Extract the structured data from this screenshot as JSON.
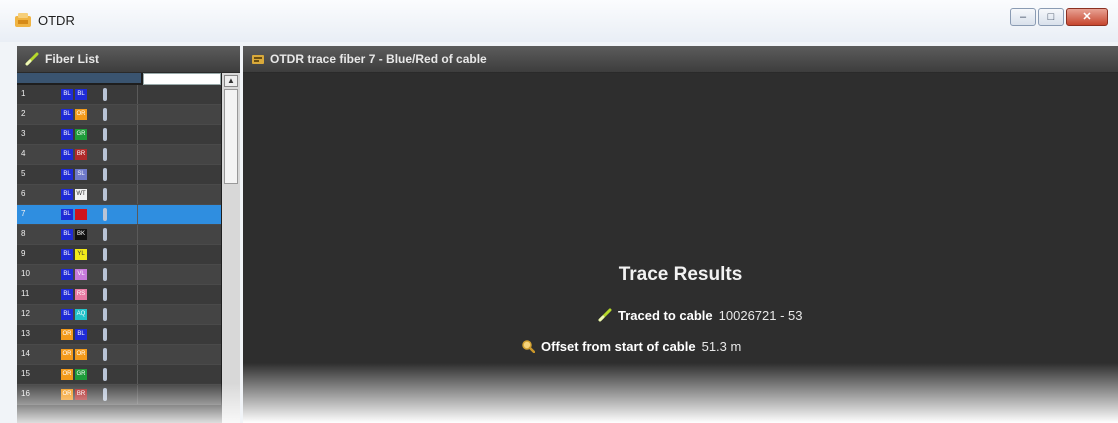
{
  "window": {
    "title": "OTDR",
    "controls": {
      "minimize": "–",
      "maximize": "□",
      "close": "✕"
    }
  },
  "fiber_list": {
    "title": "Fiber List",
    "icon": "fiber-icon",
    "rows": [
      {
        "num": "1",
        "c1": "BL",
        "c1_color": "#1f2bd6",
        "c2": "BL",
        "c2_color": "#1f2bd6"
      },
      {
        "num": "2",
        "c1": "BL",
        "c1_color": "#1f2bd6",
        "c2": "OR",
        "c2_color": "#f39a1b"
      },
      {
        "num": "3",
        "c1": "BL",
        "c1_color": "#1f2bd6",
        "c2": "GR",
        "c2_color": "#1f9b3a"
      },
      {
        "num": "4",
        "c1": "BL",
        "c1_color": "#1f2bd6",
        "c2": "BR",
        "c2_color": "#b02a2a"
      },
      {
        "num": "5",
        "c1": "BL",
        "c1_color": "#1f2bd6",
        "c2": "SL",
        "c2_color": "#6f79c8"
      },
      {
        "num": "6",
        "c1": "BL",
        "c1_color": "#1f2bd6",
        "c2": "WT",
        "c2_color": "#f2f2f2"
      },
      {
        "num": "7",
        "c1": "BL",
        "c1_color": "#1f2bd6",
        "c2": "",
        "c2_color": "#d0141d"
      },
      {
        "num": "8",
        "c1": "BL",
        "c1_color": "#1f2bd6",
        "c2": "BK",
        "c2_color": "#111111"
      },
      {
        "num": "9",
        "c1": "BL",
        "c1_color": "#1f2bd6",
        "c2": "YL",
        "c2_color": "#f2ea1a"
      },
      {
        "num": "10",
        "c1": "BL",
        "c1_color": "#1f2bd6",
        "c2": "VL",
        "c2_color": "#c77adb"
      },
      {
        "num": "11",
        "c1": "BL",
        "c1_color": "#1f2bd6",
        "c2": "RS",
        "c2_color": "#e87aa3"
      },
      {
        "num": "12",
        "c1": "BL",
        "c1_color": "#1f2bd6",
        "c2": "AQ",
        "c2_color": "#22c3c9"
      },
      {
        "num": "13",
        "c1": "OR",
        "c1_color": "#f39a1b",
        "c2": "BL",
        "c2_color": "#1f2bd6"
      },
      {
        "num": "14",
        "c1": "OR",
        "c1_color": "#f39a1b",
        "c2": "OR",
        "c2_color": "#f39a1b"
      },
      {
        "num": "15",
        "c1": "OR",
        "c1_color": "#f39a1b",
        "c2": "GR",
        "c2_color": "#1f9b3a"
      },
      {
        "num": "16",
        "c1": "OR",
        "c1_color": "#f39a1b",
        "c2": "BR",
        "c2_color": "#b02a2a"
      }
    ],
    "selected_row": "7"
  },
  "trace_panel": {
    "title": "OTDR trace fiber 7 - Blue/Red of cable",
    "icon": "otdr-icon",
    "results_title": "Trace Results",
    "traced_label": "Traced to cable",
    "traced_value": "10026721 - 53",
    "offset_label": "Offset from start of cable",
    "offset_value": "51.3 m"
  },
  "colors": {
    "selected_row": "#2f8ee0",
    "panel_bg": "#2e2e2e"
  }
}
